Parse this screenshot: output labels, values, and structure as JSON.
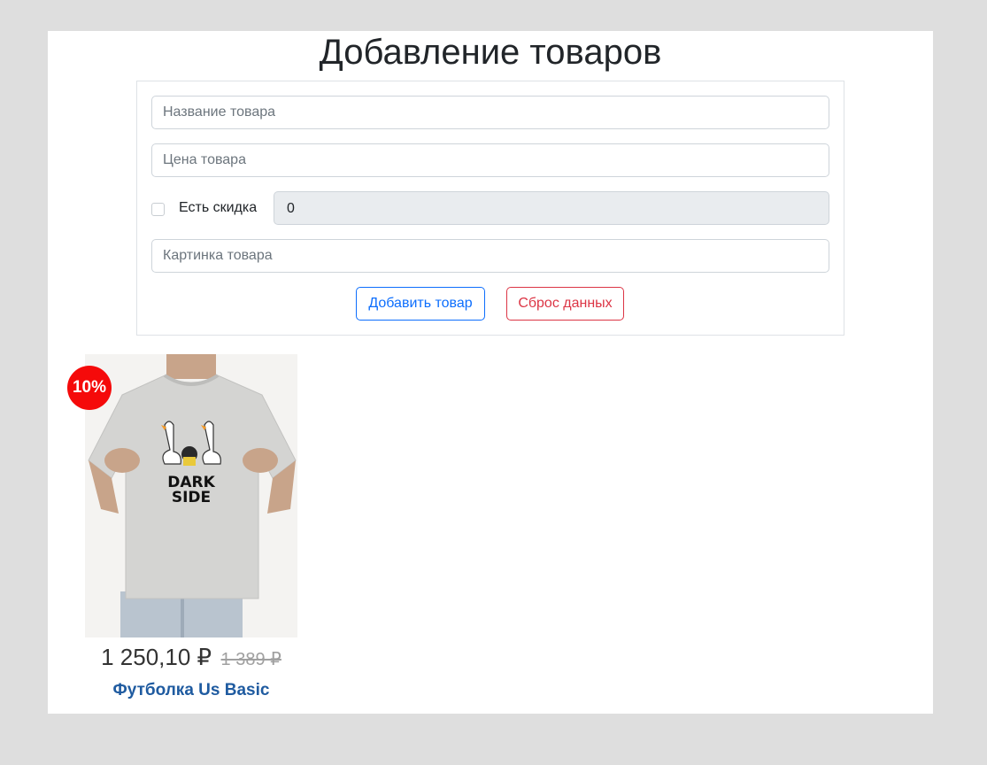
{
  "header": {
    "title": "Добавление товаров"
  },
  "form": {
    "name_placeholder": "Название товара",
    "price_placeholder": "Цена товара",
    "discount_checkbox_label": "Есть скидка",
    "discount_value": "0",
    "image_placeholder": "Картинка товара",
    "add_button": "Добавить товар",
    "reset_button": "Сброс данных"
  },
  "product": {
    "discount_badge": "10%",
    "price_new": "1 250,10 ₽",
    "price_old": "1 389 ₽",
    "name": "Футболка Us Basic",
    "shirt_text_line1": "DARK",
    "shirt_text_line2": "SIDE"
  },
  "colors": {
    "primary": "#0d6efd",
    "danger": "#dc3545",
    "badge": "#f50a0a",
    "product_name": "#1f5ba0"
  }
}
